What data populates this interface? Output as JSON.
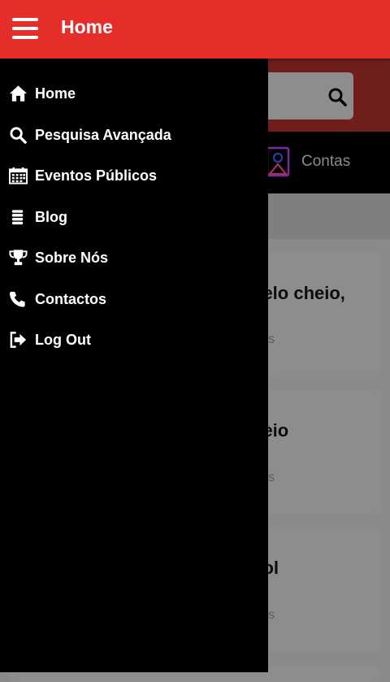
{
  "app_bar": {
    "title": "Home"
  },
  "drawer": {
    "items": [
      {
        "label": "Home",
        "icon": "home-icon"
      },
      {
        "label": "Pesquisa Avançada",
        "icon": "search-icon"
      },
      {
        "label": "Eventos Públicos",
        "icon": "calendar-icon"
      },
      {
        "label": "Blog",
        "icon": "database-icon"
      },
      {
        "label": "Sobre Nós",
        "icon": "trophy-icon"
      },
      {
        "label": "Contactos",
        "icon": "phone-icon"
      },
      {
        "label": "Log Out",
        "icon": "logout-icon"
      }
    ]
  },
  "background": {
    "tab_label": "Contas",
    "cards": [
      {
        "title_fragment": "belo cheio,",
        "sub_fragment": "s"
      },
      {
        "title_fragment": "heio",
        "sub_fragment": "s"
      },
      {
        "title_fragment": "nol",
        "sub_fragment": "s"
      }
    ]
  },
  "colors": {
    "accent": "#e52e2a",
    "drawer_bg": "#000000",
    "overlay": "#8a8a8a"
  }
}
